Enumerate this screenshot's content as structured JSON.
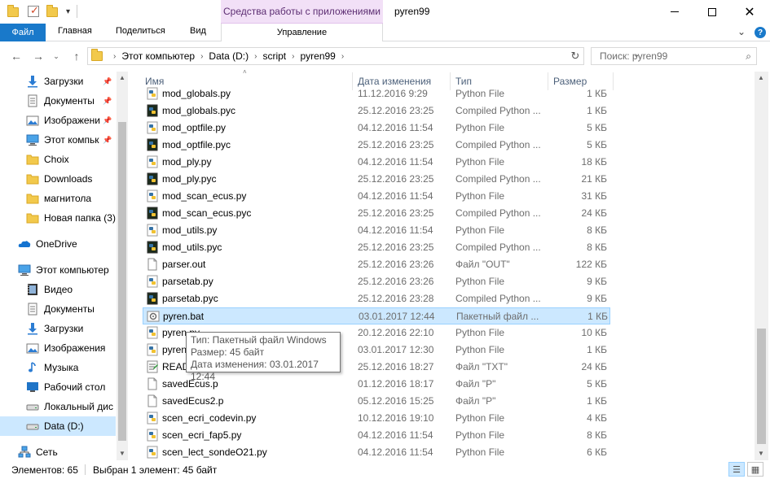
{
  "window": {
    "title": "pyren99",
    "app_tools_label": "Средства работы с приложениями"
  },
  "ribbon": {
    "tabs": [
      "Файл",
      "Главная",
      "Поделиться",
      "Вид"
    ],
    "manage_tab": "Управление"
  },
  "address": {
    "crumbs": [
      "Этот компьютер",
      "Data (D:)",
      "script",
      "pyren99"
    ]
  },
  "search": {
    "placeholder": "Поиск: pyren99"
  },
  "nav": {
    "items": [
      {
        "label": "Загрузки",
        "icon": "download-icon",
        "pinned": true
      },
      {
        "label": "Документы",
        "icon": "documents-icon",
        "pinned": true
      },
      {
        "label": "Изображени",
        "icon": "pictures-icon",
        "pinned": true
      },
      {
        "label": "Этот компьк",
        "icon": "computer-icon",
        "pinned": true
      },
      {
        "label": "Choix",
        "icon": "folder-icon",
        "pinned": false
      },
      {
        "label": "Downloads",
        "icon": "folder-icon",
        "pinned": false
      },
      {
        "label": "магнитола",
        "icon": "folder-icon",
        "pinned": false
      },
      {
        "label": "Новая папка (3)",
        "icon": "folder-icon",
        "pinned": false
      },
      {
        "label": "OneDrive",
        "icon": "onedrive-icon",
        "pinned": false
      },
      {
        "label": "Этот компьютер",
        "icon": "computer-icon",
        "pinned": false
      },
      {
        "label": "Видео",
        "icon": "video-icon",
        "pinned": false
      },
      {
        "label": "Документы",
        "icon": "documents-icon",
        "pinned": false
      },
      {
        "label": "Загрузки",
        "icon": "download-icon",
        "pinned": false
      },
      {
        "label": "Изображения",
        "icon": "pictures-icon",
        "pinned": false
      },
      {
        "label": "Музыка",
        "icon": "music-icon",
        "pinned": false
      },
      {
        "label": "Рабочий стол",
        "icon": "desktop-icon",
        "pinned": false
      },
      {
        "label": "Локальный дис",
        "icon": "drive-icon",
        "pinned": false
      },
      {
        "label": "Data (D:)",
        "icon": "drive-icon",
        "pinned": false,
        "selected": true
      },
      {
        "label": "Сеть",
        "icon": "network-icon",
        "pinned": false
      }
    ]
  },
  "columns": [
    "Имя",
    "Дата изменения",
    "Тип",
    "Размер"
  ],
  "files": [
    {
      "name": "mod_globals.py",
      "date": "11.12.2016 9:29",
      "type": "Python File",
      "size": "1 КБ",
      "icon": "py"
    },
    {
      "name": "mod_globals.pyc",
      "date": "25.12.2016 23:25",
      "type": "Compiled Python ...",
      "size": "1 КБ",
      "icon": "pyc"
    },
    {
      "name": "mod_optfile.py",
      "date": "04.12.2016 11:54",
      "type": "Python File",
      "size": "5 КБ",
      "icon": "py"
    },
    {
      "name": "mod_optfile.pyc",
      "date": "25.12.2016 23:25",
      "type": "Compiled Python ...",
      "size": "5 КБ",
      "icon": "pyc"
    },
    {
      "name": "mod_ply.py",
      "date": "04.12.2016 11:54",
      "type": "Python File",
      "size": "18 КБ",
      "icon": "py"
    },
    {
      "name": "mod_ply.pyc",
      "date": "25.12.2016 23:25",
      "type": "Compiled Python ...",
      "size": "21 КБ",
      "icon": "pyc"
    },
    {
      "name": "mod_scan_ecus.py",
      "date": "04.12.2016 11:54",
      "type": "Python File",
      "size": "31 КБ",
      "icon": "py"
    },
    {
      "name": "mod_scan_ecus.pyc",
      "date": "25.12.2016 23:25",
      "type": "Compiled Python ...",
      "size": "24 КБ",
      "icon": "pyc"
    },
    {
      "name": "mod_utils.py",
      "date": "04.12.2016 11:54",
      "type": "Python File",
      "size": "8 КБ",
      "icon": "py"
    },
    {
      "name": "mod_utils.pyc",
      "date": "25.12.2016 23:25",
      "type": "Compiled Python ...",
      "size": "8 КБ",
      "icon": "pyc"
    },
    {
      "name": "parser.out",
      "date": "25.12.2016 23:26",
      "type": "Файл \"OUT\"",
      "size": "122 КБ",
      "icon": "file"
    },
    {
      "name": "parsetab.py",
      "date": "25.12.2016 23:26",
      "type": "Python File",
      "size": "9 КБ",
      "icon": "py"
    },
    {
      "name": "parsetab.pyc",
      "date": "25.12.2016 23:28",
      "type": "Compiled Python ...",
      "size": "9 КБ",
      "icon": "pyc"
    },
    {
      "name": "pyren.bat",
      "date": "03.01.2017 12:44",
      "type": "Пакетный файл ...",
      "size": "1 КБ",
      "icon": "bat",
      "selected": true
    },
    {
      "name": "pyren.py",
      "date": "20.12.2016 22:10",
      "type": "Python File",
      "size": "10 КБ",
      "icon": "py"
    },
    {
      "name": "pyren",
      "date": "03.01.2017 12:30",
      "type": "Python File",
      "size": "1 КБ",
      "icon": "py"
    },
    {
      "name": "READ",
      "date": "25.12.2016 18:27",
      "type": "Файл \"TXT\"",
      "size": "24 КБ",
      "icon": "txt"
    },
    {
      "name": "savedEcus.p",
      "date": "01.12.2016 18:17",
      "type": "Файл \"P\"",
      "size": "5 КБ",
      "icon": "file"
    },
    {
      "name": "savedEcus2.p",
      "date": "05.12.2016 15:25",
      "type": "Файл \"P\"",
      "size": "1 КБ",
      "icon": "file"
    },
    {
      "name": "scen_ecri_codevin.py",
      "date": "10.12.2016 19:10",
      "type": "Python File",
      "size": "4 КБ",
      "icon": "py"
    },
    {
      "name": "scen_ecri_fap5.py",
      "date": "04.12.2016 11:54",
      "type": "Python File",
      "size": "8 КБ",
      "icon": "py"
    },
    {
      "name": "scen_lect_sondeO21.py",
      "date": "04.12.2016 11:54",
      "type": "Python File",
      "size": "6 КБ",
      "icon": "py"
    }
  ],
  "tooltip": {
    "line1": "Тип: Пакетный файл Windows",
    "line2": "Размер: 45 байт",
    "line3": "Дата изменения: 03.01.2017 12:44"
  },
  "status": {
    "items_count": "Элементов: 65",
    "selection": "Выбран 1 элемент: 45 байт"
  },
  "colors": {
    "accent": "#1979ca",
    "selection": "#cce8ff",
    "app_tools": "#f2e0f7"
  }
}
